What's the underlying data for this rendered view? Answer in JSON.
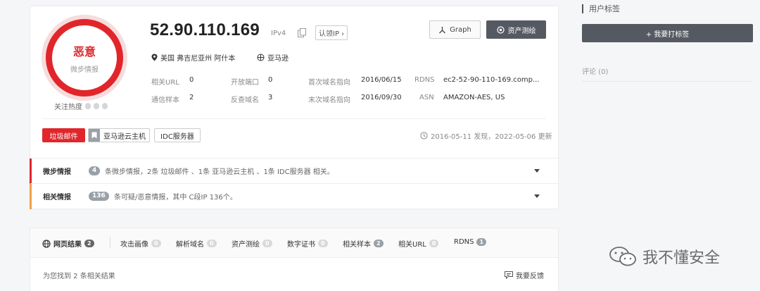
{
  "ip": {
    "address": "52.90.110.169",
    "version": "IPv4",
    "claim_label": "认领IP"
  },
  "threat": {
    "level": "恶意",
    "category": "微步情报",
    "heat_label": "关注热度"
  },
  "buttons": {
    "graph": "Graph",
    "asset": "资产测绘"
  },
  "location": {
    "place": "美国 弗吉尼亚州 阿什本",
    "isp": "亚马逊"
  },
  "stats": {
    "related_url": {
      "label": "相关URL",
      "value": "0"
    },
    "open_ports": {
      "label": "开放端口",
      "value": "0"
    },
    "first_dns": {
      "label": "首次域名指向",
      "value": "2016/06/15"
    },
    "rdns": {
      "label": "RDNS",
      "value": "ec2-52-90-110-169.comp..."
    },
    "comm_samples": {
      "label": "通信样本",
      "value": "2"
    },
    "reverse_domains": {
      "label": "反查域名",
      "value": "3"
    },
    "last_dns": {
      "label": "末次域名指向",
      "value": "2016/09/30"
    },
    "asn": {
      "label": "ASN",
      "value": "AMAZON-AES, US"
    }
  },
  "tags": {
    "spam": "垃圾邮件",
    "aws": "亚马逊云主机",
    "idc": "IDC服务器"
  },
  "found": "2016-05-11 发现，2022-05-06 更新",
  "intel": {
    "title": "微步情报",
    "count": "4",
    "desc": "条微步情报，2条 垃圾邮件 、1条 亚马逊云主机 、1条 IDC服务器 相关。"
  },
  "related": {
    "title": "相关情报",
    "count": "136",
    "desc": "条可疑/恶意情报，其中 C段IP 136个。"
  },
  "right_panel": {
    "title": "用户标签",
    "tag_button": "+ 我要打标签",
    "comments": "评论 (0)"
  },
  "tabs": [
    {
      "label": "网页结果",
      "count": "2"
    },
    {
      "label": "攻击画像",
      "count": "0"
    },
    {
      "label": "解析域名",
      "count": "0"
    },
    {
      "label": "资产测绘",
      "count": "0"
    },
    {
      "label": "数字证书",
      "count": "0"
    },
    {
      "label": "相关样本",
      "count": "2"
    },
    {
      "label": "相关URL",
      "count": "0"
    },
    {
      "label": "RDNS",
      "count": "1"
    }
  ],
  "results": {
    "count_text": "为您找到 2 条相关结果",
    "feedback": "我要反馈"
  },
  "watermark": "我不懂安全",
  "colors": {
    "malicious": "#e0262b",
    "dark_button": "#555a62",
    "related_bar": "#f0a04b"
  }
}
